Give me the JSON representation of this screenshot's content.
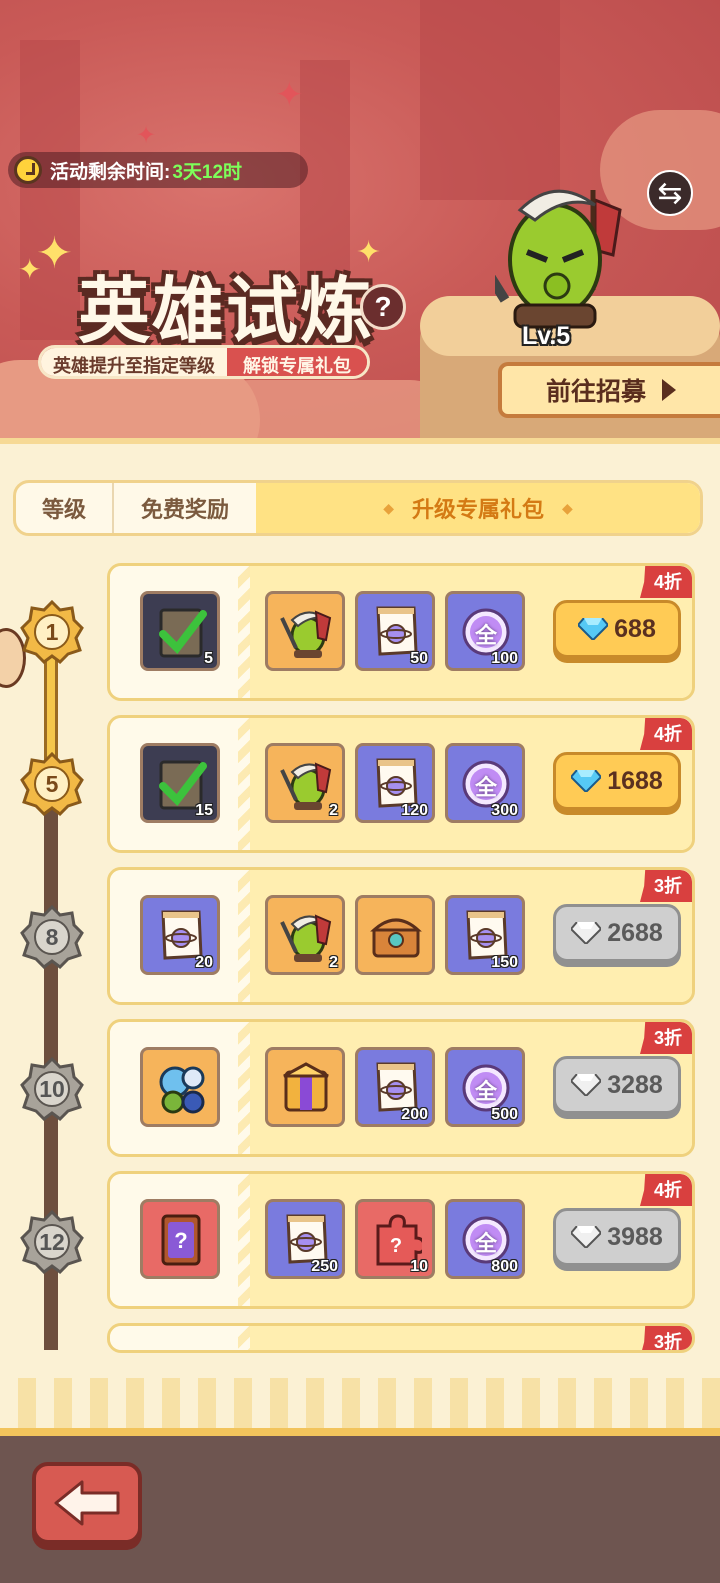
{
  "event": {
    "timer_label": "活动剩余时间:",
    "timer_value": "3天12时",
    "title": "英雄试炼",
    "subtitle_left": "英雄提升至指定等级",
    "subtitle_right": "解锁专属礼包",
    "help": "?",
    "hero_level": "Lv.5",
    "recruit_label": "前往招募"
  },
  "tabs": [
    {
      "label": "等级"
    },
    {
      "label": "免费奖励"
    },
    {
      "label": "升级专属礼包",
      "active": true
    }
  ],
  "levels": [
    "1",
    "5",
    "8",
    "10",
    "12"
  ],
  "rows": [
    {
      "discount": "4折",
      "price": "688",
      "currency_state": "gold",
      "items": [
        {
          "icon": "integral-book-claimed-icon",
          "count": "5"
        },
        {
          "icon": "hero-orc-icon",
          "count": ""
        },
        {
          "icon": "integral-scroll-icon",
          "count": "50"
        },
        {
          "icon": "all-orb-icon",
          "count": "100"
        }
      ]
    },
    {
      "discount": "4折",
      "price": "1688",
      "currency_state": "gold",
      "items": [
        {
          "icon": "integral-book-claimed-icon",
          "count": "15"
        },
        {
          "icon": "hero-orc-icon",
          "count": "2"
        },
        {
          "icon": "integral-scroll-icon",
          "count": "120"
        },
        {
          "icon": "all-orb-icon",
          "count": "300"
        }
      ]
    },
    {
      "discount": "3折",
      "price": "2688",
      "currency_state": "grey",
      "items": [
        {
          "icon": "integral-scroll-icon",
          "count": "20"
        },
        {
          "icon": "hero-orc-icon",
          "count": "2"
        },
        {
          "icon": "treasure-chest-icon",
          "count": ""
        },
        {
          "icon": "integral-scroll-icon",
          "count": "150"
        }
      ]
    },
    {
      "discount": "3折",
      "price": "3288",
      "currency_state": "grey",
      "items": [
        {
          "icon": "hero-pack-icon",
          "count": ""
        },
        {
          "icon": "mystery-box-icon",
          "count": ""
        },
        {
          "icon": "integral-scroll-icon",
          "count": "200"
        },
        {
          "icon": "all-orb-icon",
          "count": "500"
        }
      ]
    },
    {
      "discount": "4折",
      "price": "3988",
      "currency_state": "grey",
      "items": [
        {
          "icon": "mystery-card-icon",
          "count": ""
        },
        {
          "icon": "integral-scroll-icon",
          "count": "250"
        },
        {
          "icon": "puzzle-piece-icon",
          "count": "10"
        },
        {
          "icon": "all-orb-icon",
          "count": "800"
        }
      ]
    },
    {
      "discount": "3折"
    }
  ],
  "orb_char": "全",
  "colors": {
    "accent": "#d9403f",
    "gold": "#ffcb55",
    "panel": "#fbf1d4",
    "banner": "#c95a57"
  }
}
